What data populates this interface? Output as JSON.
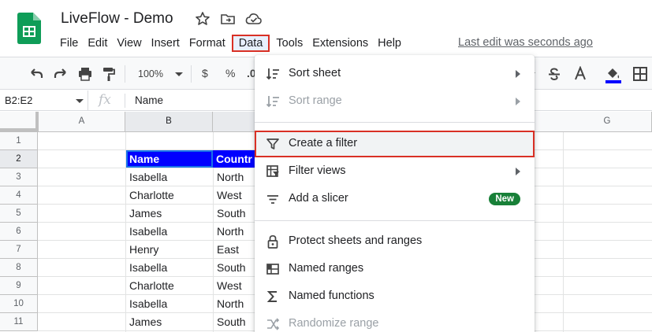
{
  "app": {
    "doc_title": "LiveFlow - Demo",
    "last_edit": "Last edit was seconds ago"
  },
  "menubar": [
    {
      "label": "File"
    },
    {
      "label": "Edit"
    },
    {
      "label": "View"
    },
    {
      "label": "Insert"
    },
    {
      "label": "Format"
    },
    {
      "label": "Data",
      "active": true
    },
    {
      "label": "Tools"
    },
    {
      "label": "Extensions"
    },
    {
      "label": "Help"
    }
  ],
  "toolbar": {
    "zoom": "100%",
    "currency": "$",
    "percent": "%",
    "decimal": ".0"
  },
  "formula_bar": {
    "name_box": "B2:E2",
    "fx": "fx",
    "value": "Name"
  },
  "grid": {
    "columns": [
      "A",
      "B",
      "G"
    ],
    "rows": [
      "1",
      "2",
      "3",
      "4",
      "5",
      "6",
      "7",
      "8",
      "9",
      "10",
      "11"
    ],
    "header": [
      "Name",
      "Countr"
    ],
    "data": [
      [
        "Isabella",
        "North"
      ],
      [
        "Charlotte",
        "West"
      ],
      [
        "James",
        "South"
      ],
      [
        "Isabella",
        "North"
      ],
      [
        "Henry",
        "East"
      ],
      [
        "Isabella",
        "South"
      ],
      [
        "Charlotte",
        "West"
      ],
      [
        "Isabella",
        "North"
      ],
      [
        "James",
        "South"
      ]
    ]
  },
  "data_menu": {
    "items": [
      {
        "label": "Sort sheet",
        "icon": "sort-icon",
        "submenu": true
      },
      {
        "label": "Sort range",
        "icon": "sort-icon",
        "submenu": true,
        "disabled": true
      },
      {
        "label": "Create a filter",
        "icon": "filter-icon",
        "highlight": true
      },
      {
        "label": "Filter views",
        "icon": "filter-views-icon",
        "submenu": true
      },
      {
        "label": "Add a slicer",
        "icon": "slicer-icon",
        "badge": "New"
      },
      {
        "label": "Protect sheets and ranges",
        "icon": "lock-icon"
      },
      {
        "label": "Named ranges",
        "icon": "named-ranges-icon"
      },
      {
        "label": "Named functions",
        "icon": "sigma-icon"
      },
      {
        "label": "Randomize range",
        "icon": "shuffle-icon",
        "disabled": true
      }
    ]
  },
  "colors": {
    "accent_red": "#d93025",
    "header_blue": "#0000ff",
    "badge_green": "#188038"
  }
}
